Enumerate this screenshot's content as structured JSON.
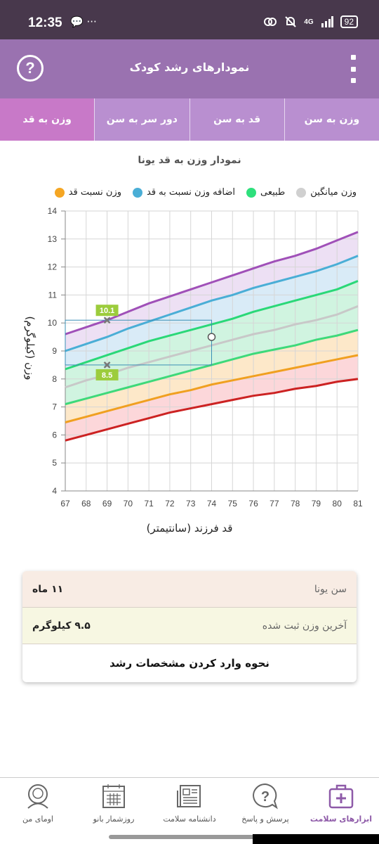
{
  "status_bar": {
    "time": "12:35",
    "icons": "💬 ···",
    "network": "4G",
    "battery": "92"
  },
  "app_bar": {
    "title": "نمودارهای رشد کودک",
    "help_label": "?"
  },
  "tabs": [
    {
      "label": "وزن به سن"
    },
    {
      "label": "قد به سن"
    },
    {
      "label": "دور سر به سن"
    },
    {
      "label": "وزن به قد"
    }
  ],
  "chart_title": "نمودار وزن به قد یونا",
  "legend": [
    {
      "label": "وزن نسبت قد",
      "color": "#f5a623"
    },
    {
      "label": "اضافه وزن نسبت به قد",
      "color": "#4aaed6"
    },
    {
      "label": "طبیعی",
      "color": "#2ee07c"
    },
    {
      "label": "وزن میانگین",
      "color": "#d0d0d0"
    }
  ],
  "chart_data": {
    "type": "line",
    "x": [
      67,
      68,
      69,
      70,
      71,
      72,
      73,
      74,
      75,
      76,
      77,
      78,
      79,
      80,
      81
    ],
    "xlabel": "قد فرزند (سانتیمتر)",
    "ylabel": "وزن (کیلوگرم)",
    "xlim": [
      67,
      81
    ],
    "ylim": [
      4,
      14
    ],
    "yticks": [
      4,
      5,
      6,
      7,
      8,
      9,
      10,
      11,
      12,
      13,
      14
    ],
    "grid": true,
    "series": [
      {
        "color": "#cc2222",
        "values": [
          5.8,
          6.0,
          6.2,
          6.4,
          6.6,
          6.8,
          6.95,
          7.1,
          7.25,
          7.4,
          7.5,
          7.65,
          7.75,
          7.9,
          8.0
        ]
      },
      {
        "color": "#f0a020",
        "values": [
          6.45,
          6.65,
          6.85,
          7.05,
          7.25,
          7.45,
          7.6,
          7.8,
          7.95,
          8.1,
          8.25,
          8.4,
          8.55,
          8.7,
          8.85
        ]
      },
      {
        "color": "#3ed97a",
        "values": [
          7.1,
          7.3,
          7.5,
          7.7,
          7.9,
          8.1,
          8.3,
          8.5,
          8.7,
          8.9,
          9.05,
          9.2,
          9.4,
          9.55,
          9.75
        ]
      },
      {
        "color": "#c8c8c8",
        "values": [
          7.7,
          7.95,
          8.15,
          8.4,
          8.6,
          8.8,
          9.0,
          9.2,
          9.4,
          9.6,
          9.75,
          9.95,
          10.1,
          10.3,
          10.6
        ]
      },
      {
        "color": "#2ad878",
        "values": [
          8.35,
          8.6,
          8.85,
          9.1,
          9.35,
          9.55,
          9.75,
          9.95,
          10.15,
          10.4,
          10.6,
          10.8,
          11.0,
          11.2,
          11.5
        ]
      },
      {
        "color": "#4aaed6",
        "values": [
          9.0,
          9.25,
          9.5,
          9.8,
          10.05,
          10.3,
          10.55,
          10.8,
          11.0,
          11.25,
          11.45,
          11.65,
          11.85,
          12.1,
          12.4
        ]
      },
      {
        "color": "#a050b8",
        "values": [
          9.6,
          9.85,
          10.1,
          10.4,
          10.7,
          10.95,
          11.2,
          11.45,
          11.7,
          11.95,
          12.2,
          12.4,
          12.65,
          12.95,
          13.25
        ]
      }
    ],
    "bands": [
      {
        "from": 0,
        "to": 1,
        "color": "#fbd0d4"
      },
      {
        "from": 1,
        "to": 2,
        "color": "#fde4c0"
      },
      {
        "from": 2,
        "to": 4,
        "color": "#c8f2da"
      },
      {
        "from": 4,
        "to": 5,
        "color": "#d2e8f6"
      },
      {
        "from": 5,
        "to": 6,
        "color": "#eadbf2"
      }
    ],
    "markers": [
      {
        "x": 69,
        "y": 10.1,
        "label": "10.1",
        "shape": "x"
      },
      {
        "x": 69,
        "y": 8.5,
        "label": "8.5",
        "shape": "x"
      },
      {
        "x": 74,
        "y": 9.5,
        "label": "",
        "shape": "circle"
      }
    ],
    "guide": {
      "x0": 67,
      "x1": 74,
      "y_low": 8.5,
      "y_high": 10.1
    }
  },
  "info_card": {
    "age_label": "سن یونا",
    "age_value": "۱۱ ماه",
    "weight_label": "آخرین وزن ثبت شده",
    "weight_value": "۹.۵ کیلوگرم",
    "link_label": "نحوه وارد کردن مشخصات رشد"
  },
  "bottom_nav": [
    {
      "label": "ابزارهای سلامت",
      "icon": "health-kit-icon",
      "active": true
    },
    {
      "label": "پرسش و پاسخ",
      "icon": "question-bubble-icon",
      "active": false
    },
    {
      "label": "دانشنامه سلامت",
      "icon": "newspaper-icon",
      "active": false
    },
    {
      "label": "روزشمار بانو",
      "icon": "calendar-icon",
      "active": false
    },
    {
      "label": "اومای من",
      "icon": "profile-icon",
      "active": false
    }
  ],
  "colors": {
    "app_bar": "#9a72b0",
    "tab_active": "#c879c8",
    "status_bar": "#48384c",
    "accent": "#8e5aa8"
  }
}
